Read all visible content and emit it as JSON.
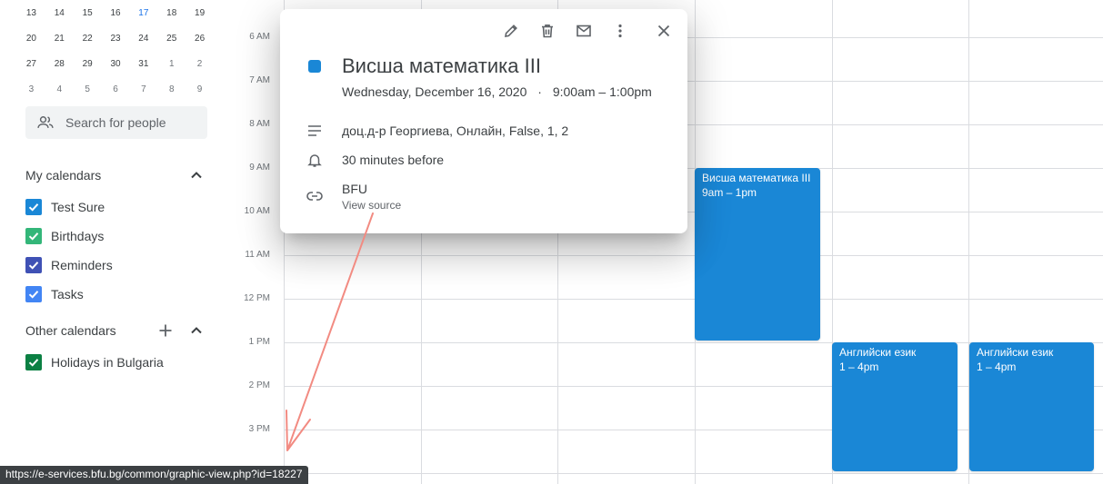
{
  "mini_calendar": {
    "rows": [
      [
        {
          "d": "13"
        },
        {
          "d": "14"
        },
        {
          "d": "15"
        },
        {
          "d": "16"
        },
        {
          "d": "17",
          "today": true
        },
        {
          "d": "18"
        },
        {
          "d": "19"
        }
      ],
      [
        {
          "d": "20"
        },
        {
          "d": "21"
        },
        {
          "d": "22"
        },
        {
          "d": "23"
        },
        {
          "d": "24"
        },
        {
          "d": "25"
        },
        {
          "d": "26"
        }
      ],
      [
        {
          "d": "27"
        },
        {
          "d": "28"
        },
        {
          "d": "29"
        },
        {
          "d": "30"
        },
        {
          "d": "31"
        },
        {
          "d": "1",
          "muted": true
        },
        {
          "d": "2",
          "muted": true
        }
      ],
      [
        {
          "d": "3",
          "muted": true
        },
        {
          "d": "4",
          "muted": true
        },
        {
          "d": "5",
          "muted": true
        },
        {
          "d": "6",
          "muted": true
        },
        {
          "d": "7",
          "muted": true
        },
        {
          "d": "8",
          "muted": true
        },
        {
          "d": "9",
          "muted": true
        }
      ]
    ]
  },
  "search": {
    "placeholder": "Search for people",
    "icon": "people-icon"
  },
  "my_calendars": {
    "title": "My calendars",
    "items": [
      {
        "label": "Test Sure",
        "color": "#1a87d6"
      },
      {
        "label": "Birthdays",
        "color": "#33b679"
      },
      {
        "label": "Reminders",
        "color": "#3f51b5"
      },
      {
        "label": "Tasks",
        "color": "#4285f4"
      }
    ]
  },
  "other_calendars": {
    "title": "Other calendars",
    "items": [
      {
        "label": "Holidays in Bulgaria",
        "color": "#0b8043"
      }
    ]
  },
  "time_labels": [
    "6 AM",
    "7 AM",
    "8 AM",
    "9 AM",
    "10 AM",
    "11 AM",
    "12 PM",
    "1 PM",
    "2 PM",
    "3 PM"
  ],
  "events": {
    "math": {
      "title": "Висша математика III",
      "time": "9am – 1pm"
    },
    "english1": {
      "title": "Английски език",
      "time": "1 – 4pm"
    },
    "english2": {
      "title": "Английски език",
      "time": "1 – 4pm"
    }
  },
  "popup": {
    "title": "Висша математика III",
    "date": "Wednesday, December 16, 2020",
    "separator": "·",
    "time": "9:00am – 1:00pm",
    "description": "доц.д-р Георгиева, Онлайн, False, 1, 2",
    "reminder": "30 minutes before",
    "source_name": "BFU",
    "source_link": "View source",
    "color": "#1a87d6"
  },
  "status_url": "https://e-services.bfu.bg/common/graphic-view.php?id=18227",
  "colors": {
    "event_blue": "#1a87d6",
    "arrow": "#f28b82"
  }
}
